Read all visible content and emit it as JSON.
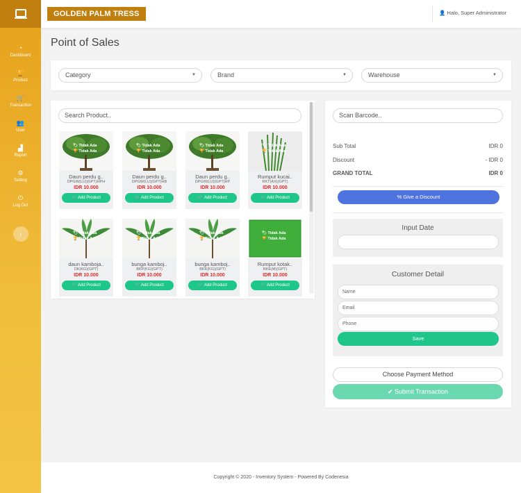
{
  "sidebar": {
    "items": [
      {
        "label": "Dashboard",
        "icon": "dashboard-icon"
      },
      {
        "label": "Product",
        "icon": "trophy-icon"
      },
      {
        "label": "Transaction",
        "icon": "cart-icon"
      },
      {
        "label": "User",
        "icon": "users-icon"
      },
      {
        "label": "Report",
        "icon": "report-icon"
      },
      {
        "label": "Setting",
        "icon": "gear-icon"
      },
      {
        "label": "Log Out",
        "icon": "power-icon"
      }
    ],
    "toggle_glyph": "›"
  },
  "topbar": {
    "brand": "GOLDEN PALM TRESS",
    "user": "Halo, Super Administrator"
  },
  "page": {
    "title": "Point of Sales"
  },
  "filters": {
    "category": "Category",
    "brand": "Brand",
    "warehouse": "Warehouse"
  },
  "search": {
    "placeholder": "Search Product.."
  },
  "products": [
    {
      "name": "Daun perdu g..",
      "code": "DPGW(LU)(GPT)HPH",
      "price": "IDR 10.000",
      "tag1": "Tidak Ada",
      "tag2": "Tidak Ada",
      "add": "Add Product"
    },
    {
      "name": "Daun perdu g..",
      "code": "DPGW(LU)(GPT)HB",
      "price": "IDR 10.000",
      "tag1": "Tidak Ada",
      "tag2": "Tidak Ada",
      "add": "Add Product"
    },
    {
      "name": "Daun perdu g..",
      "code": "DPGW(LU)(GPT)HP",
      "price": "IDR 10.000",
      "tag1": "Tidak Ada",
      "tag2": "Tidak Ada",
      "add": "Add Product"
    },
    {
      "name": "Rumput kucai..",
      "code": "RKT(AX)(GPT)",
      "price": "IDR 10.000",
      "tag1": "Tidak Ada",
      "tag2": "Tidak Ada",
      "add": "Add Product"
    },
    {
      "name": "daun kamboja..",
      "code": "DK(KG)(GPT)",
      "price": "IDR 10.000",
      "tag1": "Tidak Ada",
      "tag2": "Tidak Ada",
      "add": "Add Product"
    },
    {
      "name": "bunga kamboj..",
      "code": "BKP(KG)(GPT)",
      "price": "IDR 10.000",
      "tag1": "Tidak Ada",
      "tag2": "Tidak Ada",
      "add": "Add Product"
    },
    {
      "name": "bunga kamboj..",
      "code": "BKK(KG)(GPT)",
      "price": "IDR 10.000",
      "tag1": "Tidak Ada",
      "tag2": "Tidak Ada",
      "add": "Add Product"
    },
    {
      "name": "Rumput kotak..",
      "code": "RKE(M)(GPT)",
      "price": "IDR 10.000",
      "tag1": "Tidak Ada",
      "tag2": "Tidak Ada",
      "add": "Add Product"
    }
  ],
  "cart": {
    "barcode_placeholder": "Scan Barcode..",
    "subtotal_label": "Sub Total",
    "subtotal_value": "IDR 0",
    "discount_label": "Discount",
    "discount_value": "- IDR 0",
    "grand_label": "GRAND TOTAL",
    "grand_value": "IDR 0",
    "discount_button": "Give a Discount",
    "input_date_title": "Input Date",
    "customer_title": "Customer Detail",
    "name_placeholder": "Name",
    "email_placeholder": "Email",
    "phone_placeholder": "Phone",
    "save": "Save",
    "payment": "Choose Payment Method",
    "submit": "Submit Transaction"
  },
  "footer": {
    "text": "Copyright © 2020 - Inventory System - Powered By Codenesia"
  },
  "colors": {
    "brand": "#c07f0e",
    "sidebar": "#f0bb3a",
    "green": "#1fc689",
    "blue": "#4e73df",
    "price_red": "#e02b2b"
  }
}
